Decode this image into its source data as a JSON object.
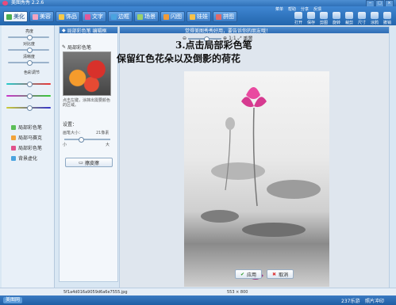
{
  "app": {
    "title": "美图秀秀 2.2.6"
  },
  "tabs": [
    {
      "label": "美化",
      "color": "#4caf50",
      "active": true
    },
    {
      "label": "美容",
      "color": "#f4a4c0"
    },
    {
      "label": "饰品",
      "color": "#f7c948"
    },
    {
      "label": "文字",
      "color": "#e05a9b"
    },
    {
      "label": "边框",
      "color": "#4aa3df"
    },
    {
      "label": "场景",
      "color": "#9bd16b"
    },
    {
      "label": "闪图",
      "color": "#f09b3a"
    },
    {
      "label": "娃娃",
      "color": "#f6c24a"
    },
    {
      "label": "拼图",
      "color": "#e06a6a"
    }
  ],
  "top_links": [
    "菜单",
    "帮助",
    "分享",
    "反馈"
  ],
  "tool_icons": [
    "打开",
    "保存",
    "剪图",
    "旋转",
    "裁剪",
    "尺寸",
    "涂鸦",
    "撤销"
  ],
  "left": {
    "brightness": "亮度",
    "contrast": "对比度",
    "sharpness": "清晰度",
    "color_title": "色彩调节",
    "effects": [
      "局部彩色笔",
      "局部马赛克",
      "局部彩色笔",
      "背景虚化"
    ]
  },
  "panel": {
    "header": "局部彩色笔  编辑框",
    "subtitle": "局部彩色笔",
    "description": "点击左键，涂抹出需要颜色的区域。",
    "settings_label": "设置：",
    "brush_label": "画笔大小：",
    "brush_value": "21像素",
    "small_label": "小",
    "big_label": "大",
    "eraser_label": "擦皮擦"
  },
  "main": {
    "header": "觉得美图秀秀好用，要告诉你的朋友哦！",
    "zoom_value": "1:1",
    "zoom_reset": "重置",
    "annotation_line1": "3.点击局部彩色笔",
    "annotation_line2": "保留红色花朵以及倒影的荷花",
    "apply_label": "应用",
    "cancel_label": "取消"
  },
  "status": {
    "filename": "5f1a4d016a9059d6a6e7555.jpg",
    "dimensions": "553 × 800"
  },
  "taskbar": {
    "start_label": "美图网",
    "right_items": [
      "237乐游",
      "照片冲印"
    ]
  }
}
